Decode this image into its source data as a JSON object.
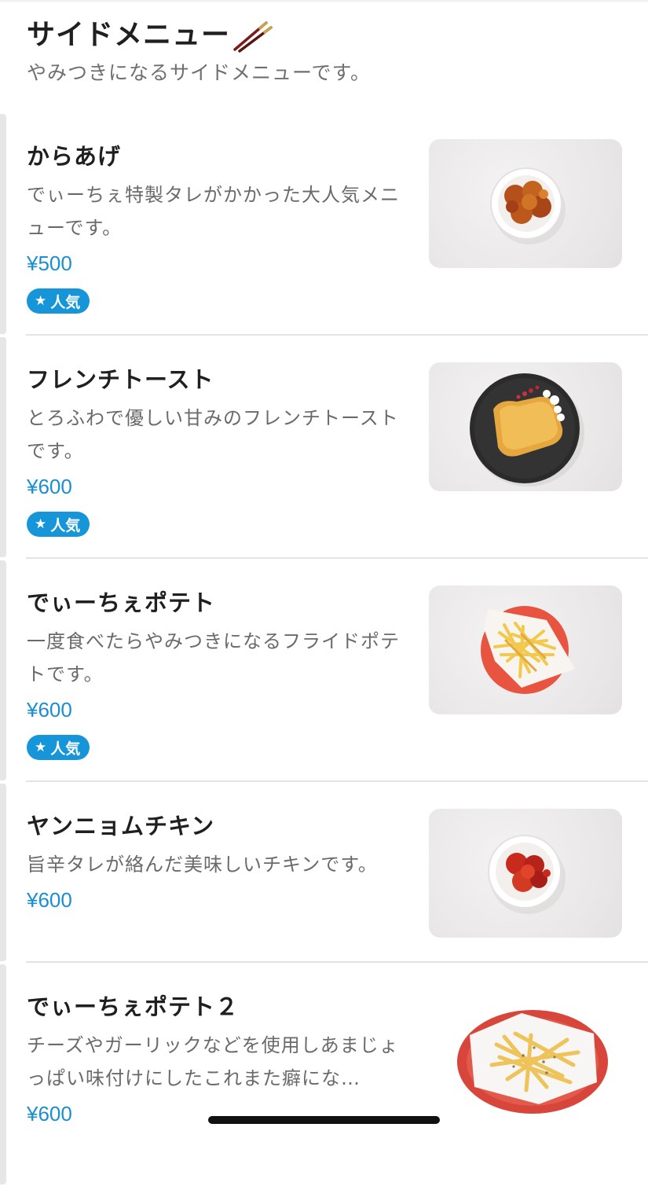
{
  "section": {
    "title": "サイドメニュー",
    "title_icon": "chopsticks-icon",
    "description": "やみつきになるサイドメニューです。"
  },
  "badge_icon": "star-icon",
  "colors": {
    "price": "#1a8fd0",
    "badge_bg": "#1696d8",
    "badge_text": "#ffffff"
  },
  "items": [
    {
      "name": "からあげ",
      "description": "でぃーちぇ特製タレがかかった大人気メニューです。",
      "price": "¥500",
      "badge": "人気",
      "photo": "karaage-photo"
    },
    {
      "name": "フレンチトースト",
      "description": "とろふわで優しい甘みのフレンチトーストです。",
      "price": "¥600",
      "badge": "人気",
      "photo": "french-toast-photo"
    },
    {
      "name": "でぃーちぇポテト",
      "description": "一度食べたらやみつきになるフライドポテトです。",
      "price": "¥600",
      "badge": "人気",
      "photo": "fries-photo"
    },
    {
      "name": "ヤンニョムチキン",
      "description": "旨辛タレが絡んだ美味しいチキンです。",
      "price": "¥600",
      "photo": "yangnyeom-chicken-photo"
    },
    {
      "name": "でぃーちぇポテト２",
      "description": "チーズやガーリックなどを使用しあまじょっぱい味付けにしたこれまた癖にな…",
      "price": "¥600",
      "photo": "cheese-fries-photo"
    }
  ]
}
